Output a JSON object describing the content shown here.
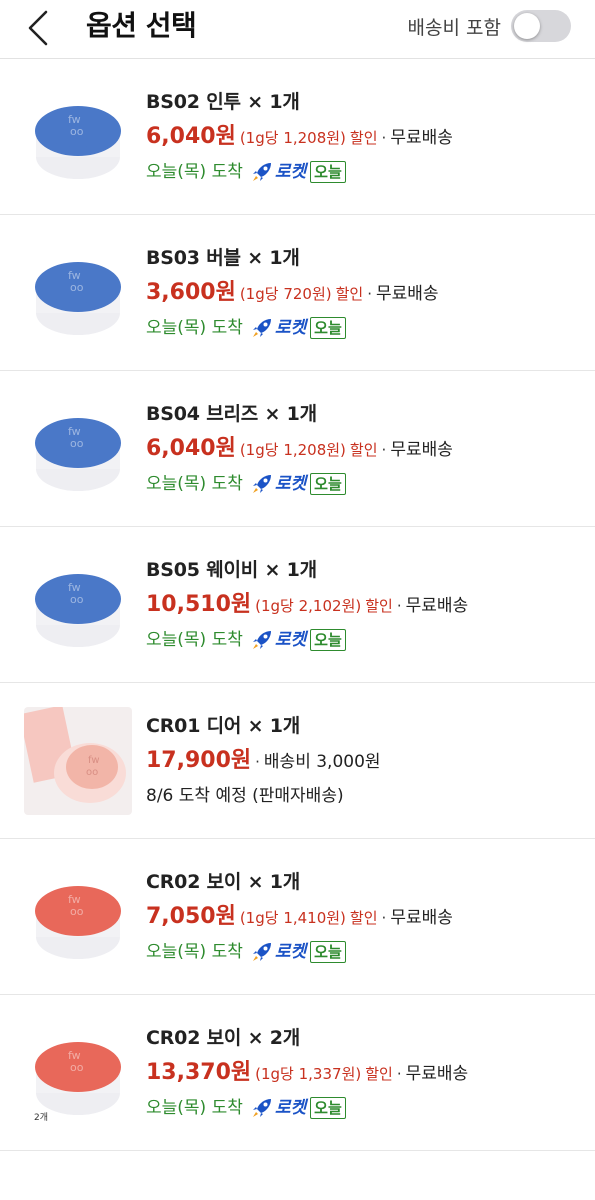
{
  "header": {
    "title": "옵션 선택",
    "ship_toggle_label": "배송비 포함"
  },
  "items": [
    {
      "name": "BS02 인투 × 1개",
      "price": "6,040원",
      "unit_price": "(1g당 1,208원)",
      "discount": "할인",
      "sep": "·",
      "shipping": "무료배송",
      "eta": "오늘(목) 도착",
      "rocket_label": "로켓",
      "today_badge": "오늘",
      "thumb_color": "#4a78c8"
    },
    {
      "name": "BS03 버블 × 1개",
      "price": "3,600원",
      "unit_price": "(1g당 720원)",
      "discount": "할인",
      "sep": "·",
      "shipping": "무료배송",
      "eta": "오늘(목) 도착",
      "rocket_label": "로켓",
      "today_badge": "오늘",
      "thumb_color": "#4a78c8"
    },
    {
      "name": "BS04 브리즈 × 1개",
      "price": "6,040원",
      "unit_price": "(1g당 1,208원)",
      "discount": "할인",
      "sep": "·",
      "shipping": "무료배송",
      "eta": "오늘(목) 도착",
      "rocket_label": "로켓",
      "today_badge": "오늘",
      "thumb_color": "#4a78c8"
    },
    {
      "name": "BS05 웨이비 × 1개",
      "price": "10,510원",
      "unit_price": "(1g당 2,102원)",
      "discount": "할인",
      "sep": "·",
      "shipping": "무료배송",
      "eta": "오늘(목) 도착",
      "rocket_label": "로켓",
      "today_badge": "오늘",
      "thumb_color": "#4a78c8"
    },
    {
      "name": "CR01 디어 × 1개",
      "price": "17,900원",
      "sep": "·",
      "shipping": "배송비 3,000원",
      "eta": "8/6 도착 예정 (판매자배송)",
      "thumb_color": "#f2b5a8"
    },
    {
      "name": "CR02 보이 × 1개",
      "price": "7,050원",
      "unit_price": "(1g당 1,410원)",
      "discount": "할인",
      "sep": "·",
      "shipping": "무료배송",
      "eta": "오늘(목) 도착",
      "rocket_label": "로켓",
      "today_badge": "오늘",
      "thumb_color": "#e8685a"
    },
    {
      "name": "CR02 보이 × 2개",
      "price": "13,370원",
      "unit_price": "(1g당 1,337원)",
      "discount": "할인",
      "sep": "·",
      "shipping": "무료배송",
      "eta": "오늘(목) 도착",
      "rocket_label": "로켓",
      "today_badge": "오늘",
      "thumb_color": "#e8685a",
      "qty_tag": "2개"
    }
  ],
  "colors": {
    "price_red": "#c8311f",
    "eta_green": "#2e8b2e",
    "rocket_blue": "#1b53c6"
  }
}
